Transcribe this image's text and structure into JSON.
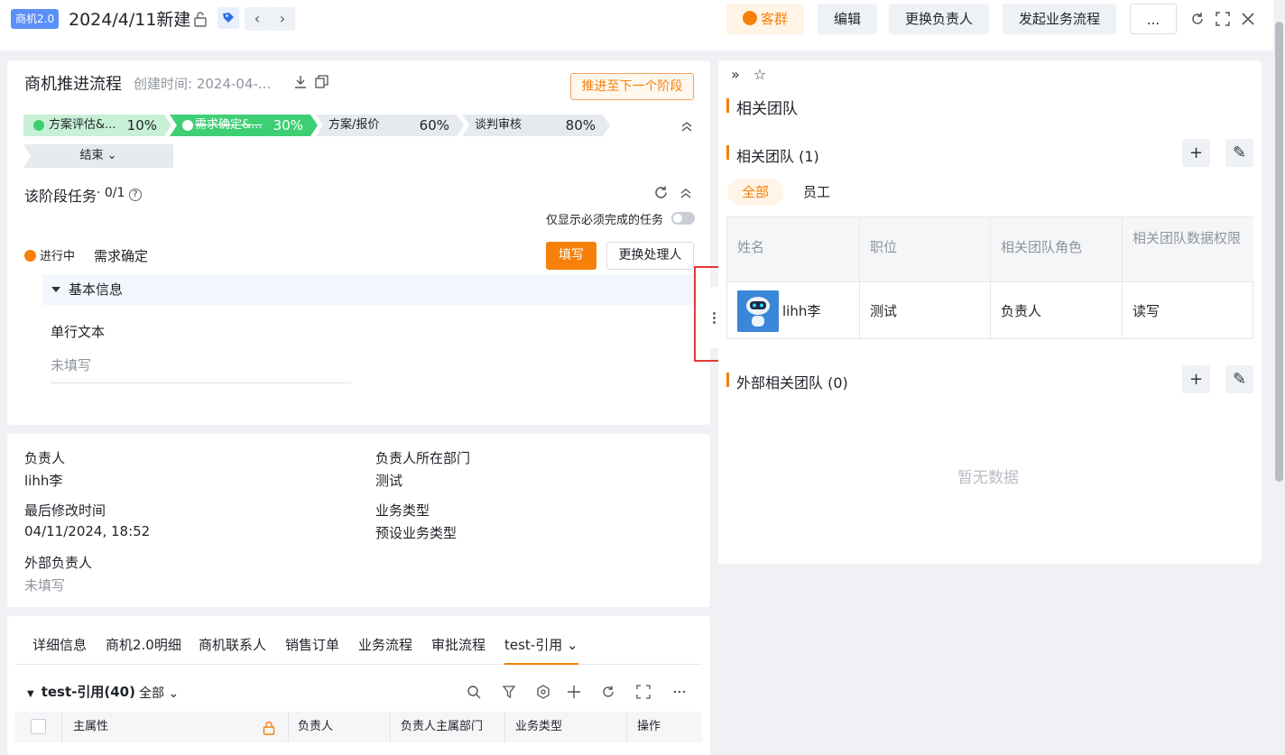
{
  "header": {
    "badge": "商机2.0",
    "title": "2024/4/11新建",
    "buttons": {
      "group": "客群",
      "edit": "编辑",
      "change_owner": "更换负责人",
      "start_flow": "发起业务流程",
      "more": "..."
    }
  },
  "flow": {
    "title": "商机推进流程",
    "created": "创建时间: 2024-04-...",
    "advance_button": "推进至下一个阶段",
    "stages": [
      {
        "name": "方案评估&...",
        "percent": "10%",
        "state": "done"
      },
      {
        "name": "需求确定&...",
        "percent": "30%",
        "state": "current"
      },
      {
        "name": "方案/报价",
        "percent": "60%",
        "state": "todo"
      },
      {
        "name": "谈判审核",
        "percent": "80%",
        "state": "todo"
      }
    ],
    "end_stage": "结束",
    "task_title": "该阶段任务",
    "task_count": "· 0/1",
    "only_required": "仅显示必须完成的任务",
    "task_status": "进行中",
    "task_name": "需求确定",
    "fill_button": "填写",
    "change_handler_button": "更换处理人",
    "section_title": "基本信息",
    "field_label": "单行文本",
    "field_value": "未填写"
  },
  "info": {
    "owner_label": "负责人",
    "owner_value": "lihh李",
    "dept_label": "负责人所在部门",
    "dept_value": "测试",
    "modified_label": "最后修改时间",
    "modified_value": "04/11/2024, 18:52",
    "biztype_label": "业务类型",
    "biztype_value": "预设业务类型",
    "ext_owner_label": "外部负责人",
    "ext_owner_value": "未填写"
  },
  "tabs": {
    "items": [
      "详细信息",
      "商机2.0明细",
      "商机联系人",
      "销售订单",
      "业务流程",
      "审批流程",
      "test-引用"
    ],
    "sub_title": "test-引用(40)",
    "sub_filter": "全部",
    "columns": [
      "主属性",
      "负责人",
      "负责人主属部门",
      "业务类型",
      "操作"
    ]
  },
  "team": {
    "heading": "相关团队",
    "related_title": "相关团队 (1)",
    "filter_all": "全部",
    "filter_staff": "员工",
    "columns": [
      "姓名",
      "职位",
      "相关团队角色",
      "相关团队数据权限"
    ],
    "row": {
      "name": "lihh李",
      "position": "测试",
      "role": "负责人",
      "permission": "读写"
    },
    "external_title": "外部相关团队 (0)",
    "empty_text": "暂无数据"
  },
  "colors": {
    "accent": "#f5800a",
    "stage_done": "#c8f0d6",
    "stage_current": "#3ecf74",
    "badge": "#5b8ff9"
  }
}
